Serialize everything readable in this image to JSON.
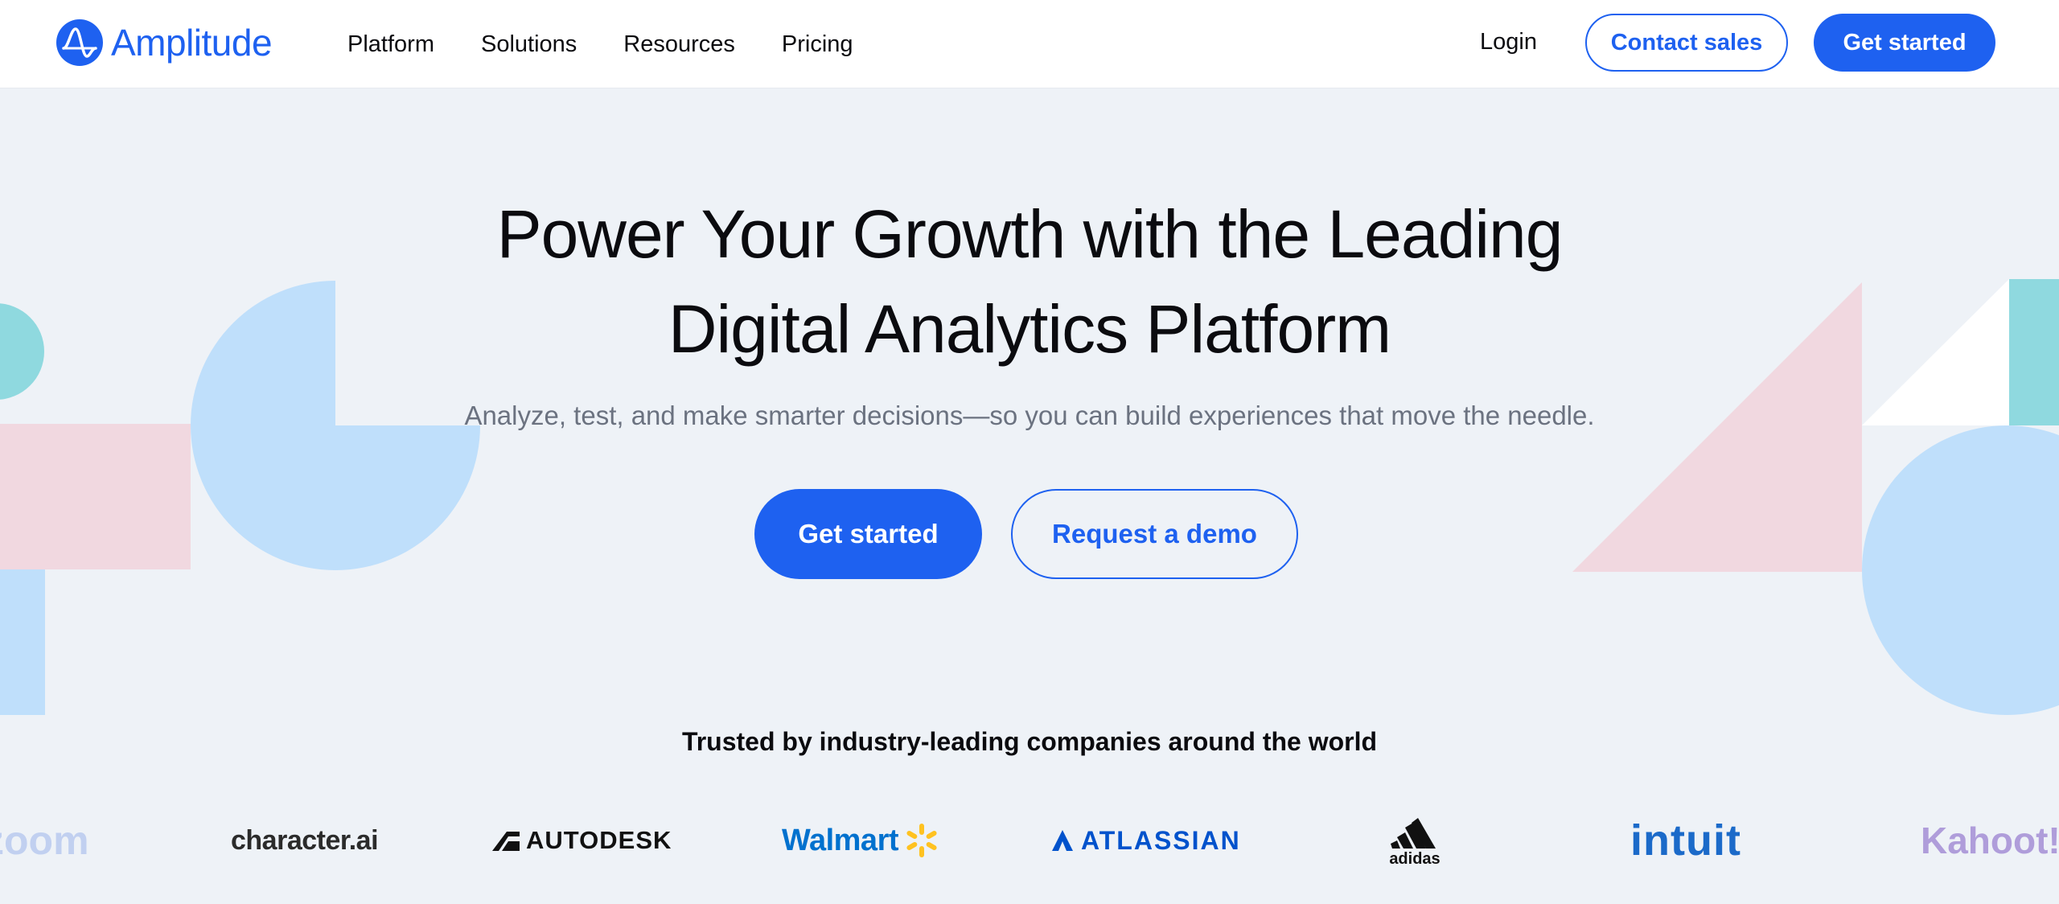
{
  "nav": {
    "brand": "Amplitude",
    "menu": [
      {
        "label": "Platform"
      },
      {
        "label": "Solutions"
      },
      {
        "label": "Resources"
      },
      {
        "label": "Pricing"
      }
    ],
    "login": "Login",
    "contact_sales": "Contact sales",
    "get_started": "Get started"
  },
  "hero": {
    "title_line1": "Power Your Growth with the Leading",
    "title_line2": "Digital Analytics Platform",
    "subtitle": "Analyze, test, and make smarter decisions—so you can build experiences that move the needle.",
    "primary_cta": "Get started",
    "secondary_cta": "Request a demo"
  },
  "trusted": {
    "heading": "Trusted by industry-leading companies around the world",
    "logos": [
      "zoom",
      "character.ai",
      "AUTODESK",
      "Walmart",
      "ATLASSIAN",
      "adidas",
      "intuit",
      "Kahoot!"
    ]
  },
  "colors": {
    "brand_blue": "#1e61f0",
    "background": "#eef2f7",
    "shape_light_blue": "#bfdffb",
    "shape_pink": "#f1d8e0",
    "shape_teal": "#8fd9df"
  },
  "icons": [
    "amplitude-logo-icon",
    "walmart-spark-icon",
    "atlassian-icon",
    "adidas-stripes-icon",
    "autodesk-icon"
  ]
}
